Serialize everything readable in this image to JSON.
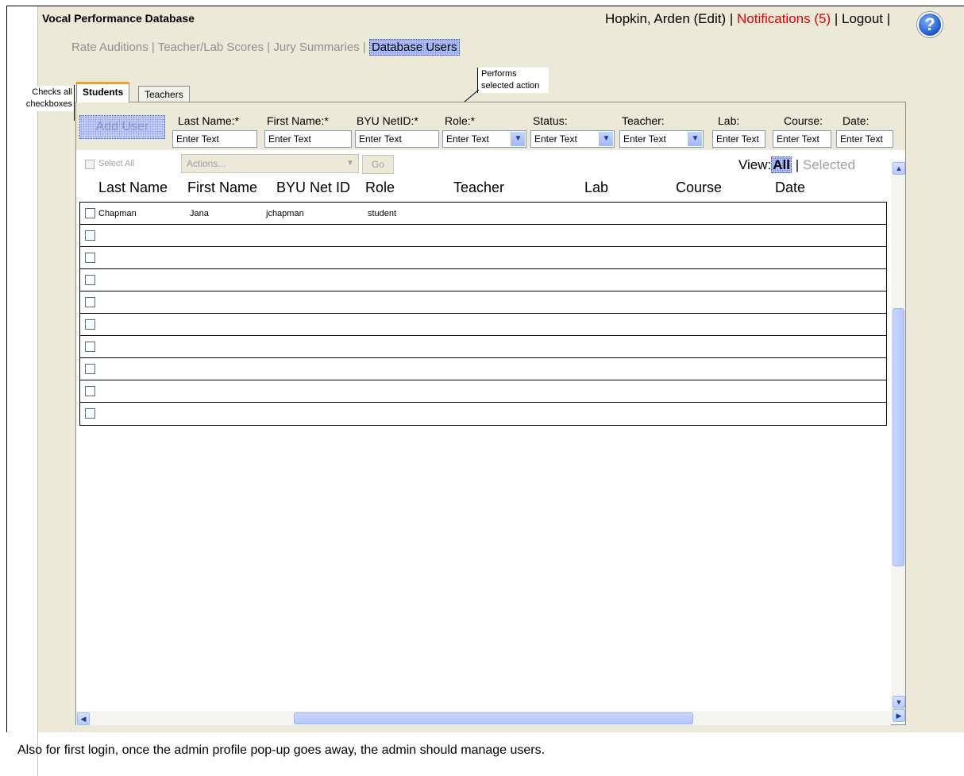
{
  "app": {
    "title": "Vocal Performance Database"
  },
  "user_bar": {
    "user": "Hopkin, Arden (Edit)",
    "sep1": " | ",
    "notifications": "Notifications (5)",
    "sep2": " | ",
    "logout": "Logout",
    "sep3": " |",
    "help_glyph": "?"
  },
  "nav": {
    "items": [
      "Rate Auditions",
      "Teacher/Lab Scores",
      "Jury Summaries",
      "Database Users"
    ],
    "separator": " | "
  },
  "annotations": {
    "checks_all": "Checks all checkboxes",
    "performs_action": "Performs selected action"
  },
  "tabs": [
    {
      "label": "Students"
    },
    {
      "label": "Teachers"
    }
  ],
  "filters": {
    "add_user": "Add User",
    "fields": [
      {
        "label": "Last Name:*",
        "value": "Enter Text"
      },
      {
        "label": "First Name:*",
        "value": "Enter Text"
      },
      {
        "label": "BYU NetID:*",
        "value": "Enter Text"
      },
      {
        "label": "Role:*",
        "value": "Enter Text"
      },
      {
        "label": "Status:",
        "value": "Enter Text"
      },
      {
        "label": "Teacher:",
        "value": "Enter Text"
      },
      {
        "label": "Lab:",
        "value": "Enter Text"
      },
      {
        "label": "Course:",
        "value": "Enter Text"
      },
      {
        "label": "Date:",
        "value": "Enter Text"
      }
    ]
  },
  "actions": {
    "select_all": "Select All",
    "actions_placeholder": "Actions...",
    "go": "Go",
    "view_label": "View:",
    "view_all": "All",
    "view_sep": " | ",
    "view_selected": "Selected"
  },
  "table": {
    "columns": [
      "Last Name",
      "First Name",
      "BYU Net ID",
      "Role",
      "Teacher",
      "Lab",
      "Course",
      "Date"
    ],
    "rows": [
      [
        "Chapman",
        "Jana",
        "jchapman",
        "student"
      ],
      [],
      [],
      [],
      [],
      [],
      [],
      [],
      [],
      []
    ]
  },
  "footer": {
    "note": "Also for first login, once the admin profile pop-up goes away, the admin should manage users."
  },
  "colors": {
    "panel_bg": "#ece9d8",
    "notification_red": "#e00000",
    "tab_accent": "#f0a030",
    "highlight": "#b8c8ff"
  },
  "icons": {
    "help": "help-icon",
    "dropdown": "chevron-down-icon",
    "scroll_up": "arrow-up-icon",
    "scroll_down": "arrow-down-icon",
    "scroll_left": "arrow-left-icon"
  }
}
